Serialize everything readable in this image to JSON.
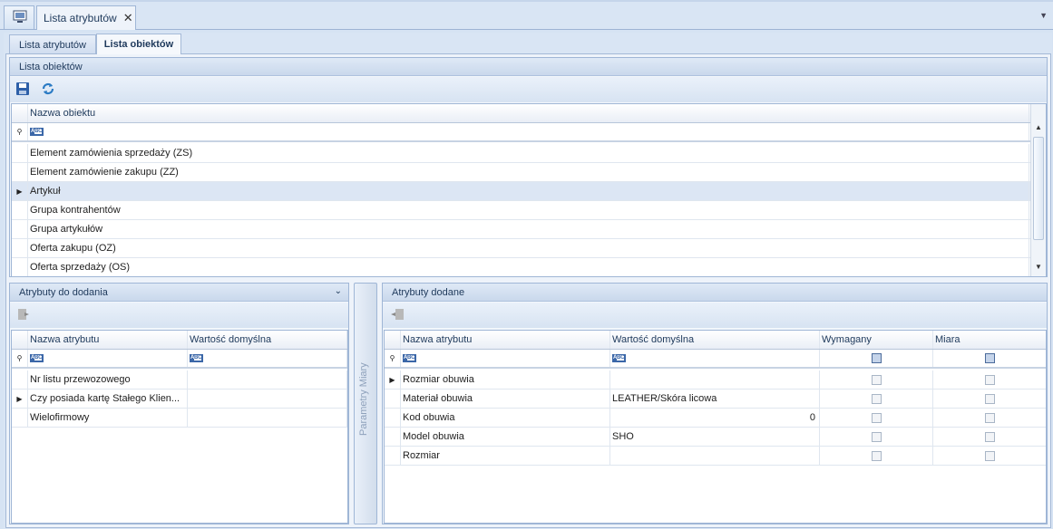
{
  "doc_tab": {
    "title": "Lista atrybutów",
    "close": "✕"
  },
  "page_tabs": [
    "Lista atrybutów",
    "Lista obiektów"
  ],
  "objects_panel": {
    "title": "Lista obiektów",
    "column": "Nazwa obiektu",
    "rows": [
      "Element zamówienia sprzedaży (ZS)",
      "Element zamówienie zakupu (ZZ)",
      "Artykuł",
      "Grupa kontrahentów",
      "Grupa artykułów",
      "Oferta zakupu (OZ)",
      "Oferta sprzedaży (OS)"
    ],
    "selected_index": 2
  },
  "to_add_panel": {
    "title": "Atrybuty do dodania",
    "columns": [
      "Nazwa atrybutu",
      "Wartość domyślna"
    ],
    "rows": [
      {
        "name": "Nr listu przewozowego",
        "value": ""
      },
      {
        "name": "Czy posiada kartę Stałego Klien...",
        "value": ""
      },
      {
        "name": "Wielofirmowy",
        "value": ""
      }
    ],
    "selected_index": 1
  },
  "divider_label": "Parametry Miary",
  "added_panel": {
    "title": "Atrybuty dodane",
    "columns": [
      "Nazwa atrybutu",
      "Wartość domyślna",
      "Wymagany",
      "Miara"
    ],
    "rows": [
      {
        "name": "Rozmiar obuwia",
        "value": ""
      },
      {
        "name": "Materiał obuwia",
        "value": "LEATHER/Skóra licowa"
      },
      {
        "name": "Kod obuwia",
        "value": "0"
      },
      {
        "name": "Model obuwia",
        "value": "SHO"
      },
      {
        "name": "Rozmiar",
        "value": ""
      }
    ],
    "selected_index": 0
  },
  "filter_glyph": "ABC",
  "colors": {
    "accent": "#3b67a8",
    "panel_header": "#c9d8ec",
    "selected_row": "#dce6f4"
  }
}
